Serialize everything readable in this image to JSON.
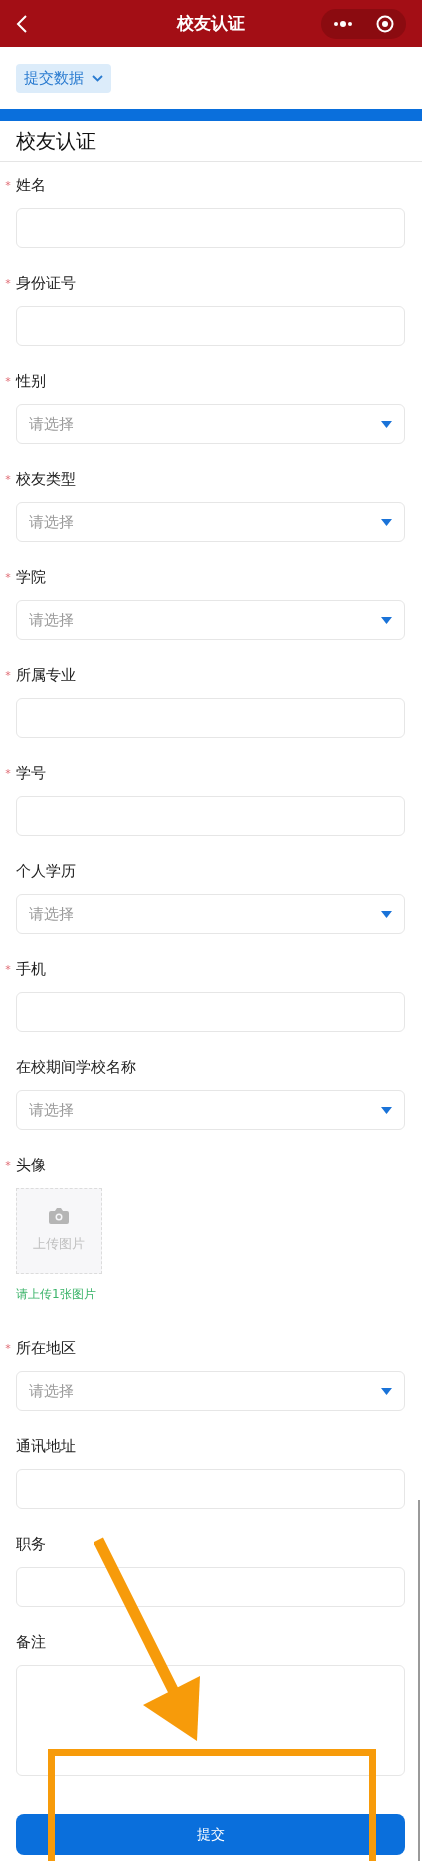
{
  "nav_bar": {
    "title": "校友认证"
  },
  "data_menu": {
    "label": "提交数据"
  },
  "form": {
    "title": "校友认证",
    "required_mark": "*",
    "fields": [
      {
        "kind": "text",
        "label": "姓名",
        "required": true
      },
      {
        "kind": "text",
        "label": "身份证号",
        "required": true
      },
      {
        "kind": "select",
        "label": "性别",
        "required": true,
        "placeholder": "请选择"
      },
      {
        "kind": "select",
        "label": "校友类型",
        "required": true,
        "placeholder": "请选择"
      },
      {
        "kind": "select",
        "label": "学院",
        "required": true,
        "placeholder": "请选择"
      },
      {
        "kind": "text",
        "label": "所属专业",
        "required": true
      },
      {
        "kind": "text",
        "label": "学号",
        "required": true
      },
      {
        "kind": "select",
        "label": "个人学历",
        "required": false,
        "placeholder": "请选择"
      },
      {
        "kind": "text",
        "label": "手机",
        "required": true
      },
      {
        "kind": "select",
        "label": "在校期间学校名称",
        "required": false,
        "placeholder": "请选择"
      },
      {
        "kind": "upload",
        "label": "头像",
        "required": true,
        "upload_label": "上传图片",
        "hint": "请上传1张图片"
      },
      {
        "kind": "select",
        "label": "所在地区",
        "required": true,
        "placeholder": "请选择"
      },
      {
        "kind": "text",
        "label": "通讯地址",
        "required": false
      },
      {
        "kind": "text",
        "label": "职务",
        "required": false
      },
      {
        "kind": "textarea",
        "label": "备注",
        "required": false
      }
    ],
    "submit": "提交"
  }
}
